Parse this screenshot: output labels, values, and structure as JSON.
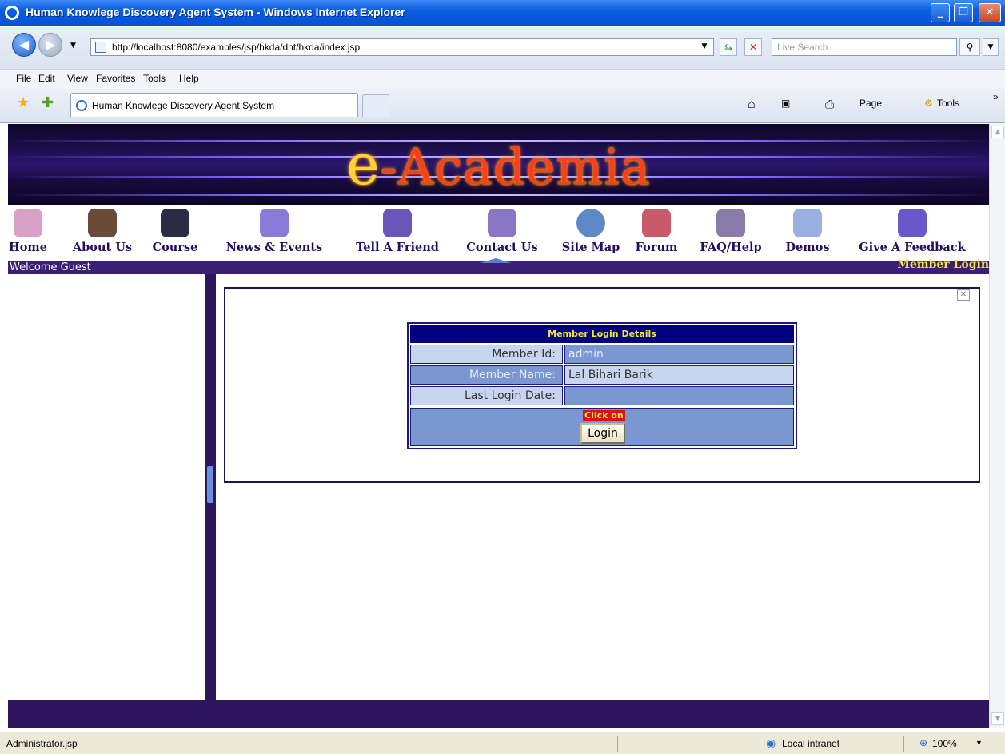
{
  "window": {
    "title": "Human Knowlege Discovery Agent System - Windows Internet Explorer",
    "minimize_label": "_",
    "restore_label": "❐",
    "close_label": "✕"
  },
  "addressbar": {
    "url": "http://localhost:8080/examples/jsp/hkda/dht/hkda/index.jsp",
    "search_placeholder": "Live Search"
  },
  "menu": [
    "File",
    "Edit",
    "View",
    "Favorites",
    "Tools",
    "Help"
  ],
  "tabs": {
    "active_label": "Human Knowlege Discovery Agent System"
  },
  "toolbar": {
    "page_label": "Page",
    "tools_label": "Tools"
  },
  "banner": {
    "logo_e": "e",
    "logo_rest": "-Academia"
  },
  "nav": {
    "items": [
      {
        "label": "Home",
        "icon": "home-icon",
        "color": "#d9a0c8"
      },
      {
        "label": "About Us",
        "icon": "people-icon",
        "color": "#6b4a3a"
      },
      {
        "label": "Course",
        "icon": "graduation-cap-icon",
        "color": "#2b2b45"
      },
      {
        "label": "News & Events",
        "icon": "newspaper-icon",
        "color": "#8b7bd8"
      },
      {
        "label": "Tell A Friend",
        "icon": "friends-icon",
        "color": "#6a55b8"
      },
      {
        "label": "Contact Us",
        "icon": "phone-icon",
        "color": "#8a76c4"
      },
      {
        "label": "Site Map",
        "icon": "magnifier-icon",
        "color": "#5e88c8"
      },
      {
        "label": "Forum",
        "icon": "forum-icon",
        "color": "#c85a6a"
      },
      {
        "label": "FAQ/Help",
        "icon": "help-icon",
        "color": "#8a7aa8"
      },
      {
        "label": "Demos",
        "icon": "demos-icon",
        "color": "#9ab0e0"
      },
      {
        "label": "Give A Feedback",
        "icon": "feedback-icon",
        "color": "#6a58c8"
      }
    ]
  },
  "welcome": {
    "text": "Welcome Guest",
    "member_login": "Member Login"
  },
  "login_details": {
    "heading": "Member Login Details",
    "member_id_label": "Member Id:",
    "member_id_value": "admin",
    "member_name_label": "Member Name:",
    "member_name_value": "Lal Bihari Barik",
    "last_login_label": "Last Login Date:",
    "last_login_value": "",
    "click_on": "Click on",
    "login_button": "Login"
  },
  "statusbar": {
    "text": "Administrator.jsp",
    "zone": "Local intranet",
    "zoom": "100%"
  }
}
